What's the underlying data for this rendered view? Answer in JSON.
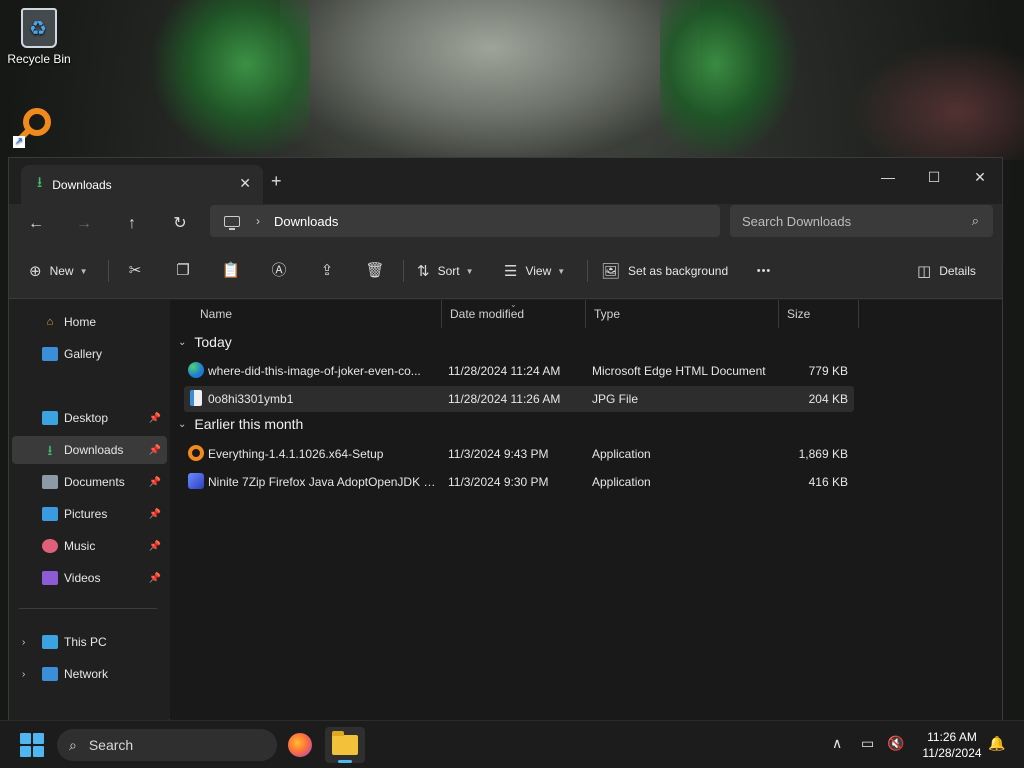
{
  "desktop": {
    "icons": [
      {
        "label": "Recycle Bin"
      }
    ]
  },
  "window": {
    "tab": {
      "title": "Downloads"
    },
    "controls": {
      "minimize": "—",
      "maximize": "☐",
      "close": "✕"
    },
    "nav": {
      "breadcrumb": "Downloads",
      "search_placeholder": "Search Downloads"
    },
    "toolbar": {
      "new_label": "New",
      "sort_label": "Sort",
      "view_label": "View",
      "set_background_label": "Set as background",
      "details_label": "Details",
      "more_label": "•••"
    },
    "sidebar": {
      "items": [
        {
          "label": "Home"
        },
        {
          "label": "Gallery"
        },
        {
          "label": "Desktop"
        },
        {
          "label": "Downloads"
        },
        {
          "label": "Documents"
        },
        {
          "label": "Pictures"
        },
        {
          "label": "Music"
        },
        {
          "label": "Videos"
        },
        {
          "label": "This PC"
        },
        {
          "label": "Network"
        }
      ]
    },
    "columns": {
      "name": "Name",
      "date": "Date modified",
      "type": "Type",
      "size": "Size"
    },
    "groups": [
      {
        "label": "Today",
        "files": [
          {
            "name": "where-did-this-image-of-joker-even-co...",
            "date": "11/28/2024 11:24 AM",
            "type": "Microsoft Edge HTML Document",
            "size": "779 KB",
            "icon": "edge-icon"
          },
          {
            "name": "0o8hi3301ymb1",
            "date": "11/28/2024 11:26 AM",
            "type": "JPG File",
            "size": "204 KB",
            "icon": "image-file-icon"
          }
        ]
      },
      {
        "label": "Earlier this month",
        "files": [
          {
            "name": "Everything-1.4.1.1026.x64-Setup",
            "date": "11/3/2024 9:43 PM",
            "type": "Application",
            "size": "1,869 KB",
            "icon": "everything-icon"
          },
          {
            "name": "Ninite 7Zip Firefox Java AdoptOpenJDK x...",
            "date": "11/3/2024 9:30 PM",
            "type": "Application",
            "size": "416 KB",
            "icon": "ninite-icon"
          }
        ]
      }
    ]
  },
  "taskbar": {
    "search_label": "Search",
    "time": "11:26 AM",
    "date": "11/28/2024"
  },
  "colors": {
    "accent": "#4fb6f2",
    "download_green": "#3ec46d"
  }
}
